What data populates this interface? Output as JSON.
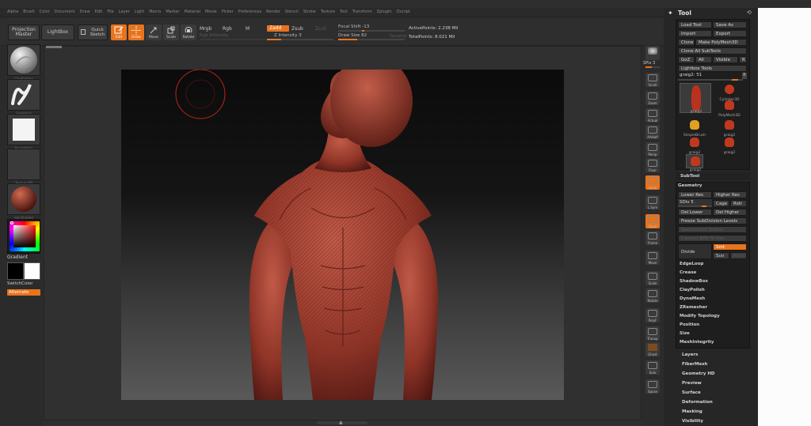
{
  "menu": [
    "Alpha",
    "Brush",
    "Color",
    "Document",
    "Draw",
    "Edit",
    "File",
    "Layer",
    "Light",
    "Macro",
    "Marker",
    "Material",
    "Movie",
    "Picker",
    "Preferences",
    "Render",
    "Stencil",
    "Stroke",
    "Texture",
    "Tool",
    "Transform",
    "Zplugin",
    "Zscript"
  ],
  "top_shelf": {
    "projection_master": "Projection Master",
    "lightbox": "LightBox",
    "quick_sketch": "Quick Sketch",
    "edit": "Edit",
    "draw": "Draw",
    "move": "Move",
    "scale": "Scale",
    "rotate": "Rotate",
    "mrgb": "Mrgb",
    "rgb": "Rgb",
    "m": "M",
    "rgb_intensity": "Rgb Intensity",
    "zadd": "Zadd",
    "zsub": "Zsub",
    "zcut": "Zcut",
    "z_intensity": "Z Intensity 3",
    "focal_shift": "Focal Shift -13",
    "draw_size": "Draw Size 82",
    "dynamic": "Dynamic",
    "active_points": "ActivePoints: 2.238 Mil",
    "total_points": "TotalPoints: 8.021 Mil"
  },
  "left_shelf": {
    "brush_label": "ClayBuildup",
    "stroke_label": "FreeHand",
    "alpha_label": "BrushAlpha",
    "texture_label": "Texture Off",
    "material_label": "SkinShade4",
    "gradient": "Gradient",
    "switch_color": "SwitchColor",
    "alternate": "Alternate"
  },
  "right_shelf": [
    "SPix 3",
    "Scroll",
    "Zoom",
    "Actual",
    "AAHalf",
    "Persp",
    "Floor",
    "Local",
    "L.Sym",
    "Qxyz",
    "Frame",
    "Move",
    "Scale",
    "Rotate",
    "PolyF",
    "Transp",
    "Ghost",
    "Solo",
    "Xpose"
  ],
  "tool_palette": {
    "title": "Tool",
    "load_tool": "Load Tool",
    "save_as": "Save As",
    "import": "Import",
    "export": "Export",
    "clone": "Clone",
    "make_polymesh": "Make PolyMesh3D",
    "clone_all": "Clone All SubTools",
    "goz": "GoZ",
    "all": "All",
    "visible": "Visible",
    "r": "R",
    "lightbox_tools": "Lightbox Tools",
    "current_tool": "graig2: 51",
    "thumbs": [
      "graig2",
      "Cylinder3D",
      "PolyMesh3D",
      "SimpleBrush",
      "graig2",
      "graig2",
      "graig2",
      "graig2"
    ],
    "subtool": "SubTool",
    "geometry": "Geometry",
    "lower_res": "Lower Res",
    "higher_res": "Higher Res",
    "sdiv": "SDiv 5",
    "cage": "Cage",
    "rstr": "Rstr",
    "del_lower": "Del Lower",
    "del_higher": "Del Higher",
    "freeze": "Freeze SubDivision Levels",
    "reconstruct": "Reconstruct Subdiv",
    "convert_bpr": "Convert BPR To Geo",
    "divide": "Divide",
    "smt": "Smt",
    "suv": "Suv",
    "reuv": "ReUV",
    "geometry_items": [
      "EdgeLoop",
      "Crease",
      "ShadowBox",
      "ClayPolish",
      "DynaMesh",
      "ZRemesher",
      "Modify Topology",
      "Position",
      "Size",
      "MeshIntegrity"
    ],
    "sections": [
      "Layers",
      "FiberMesh",
      "Geometry HD",
      "Preview",
      "Surface",
      "Deformation",
      "Masking",
      "Visibility"
    ]
  },
  "colors": {
    "accent": "#e8731d",
    "model": "#9a3a2e"
  }
}
